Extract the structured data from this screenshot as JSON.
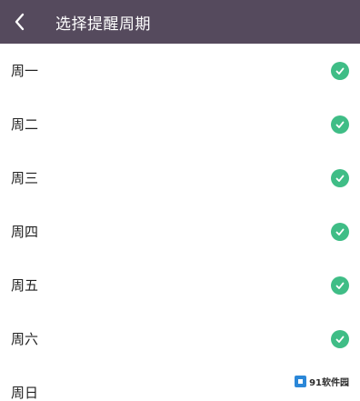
{
  "header": {
    "title": "选择提醒周期",
    "back_icon": "chevron-left-icon"
  },
  "days": [
    {
      "label": "周一",
      "checked": true
    },
    {
      "label": "周二",
      "checked": true
    },
    {
      "label": "周三",
      "checked": true
    },
    {
      "label": "周四",
      "checked": true
    },
    {
      "label": "周五",
      "checked": true
    },
    {
      "label": "周六",
      "checked": true
    },
    {
      "label": "周日",
      "checked": true
    }
  ],
  "watermark": {
    "text": "91软件园"
  },
  "colors": {
    "header_bg": "#554a5d",
    "check": "#3fbd86",
    "text": "#222222"
  }
}
